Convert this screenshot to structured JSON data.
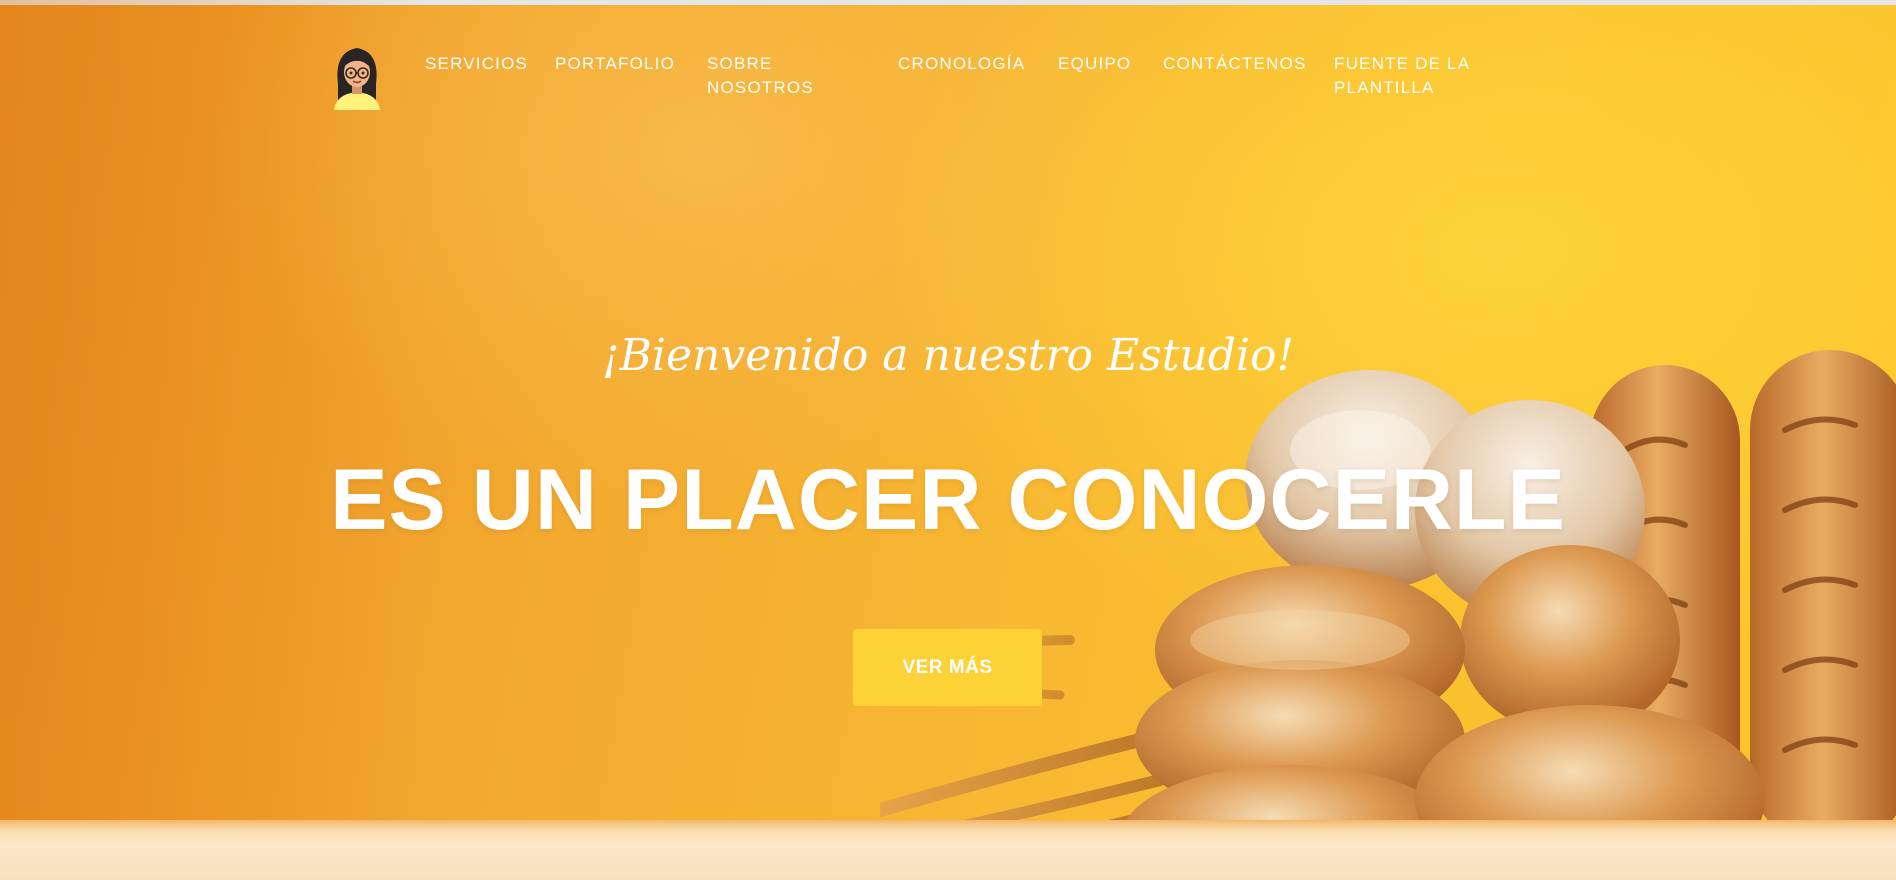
{
  "colors": {
    "accent": "#fed136",
    "text": "#ffffff",
    "background_left": "#e88d20",
    "background_right": "#fcc52c"
  },
  "navbar": {
    "logo_icon": "girl-avatar-icon",
    "items": [
      {
        "label": "SERVICIOS"
      },
      {
        "label": "PORTAFOLIO"
      },
      {
        "label": "SOBRE NOSOTROS"
      },
      {
        "label": "CRONOLOGÍA"
      },
      {
        "label": "EQUIPO"
      },
      {
        "label": "CONTÁCTENOS"
      },
      {
        "label": "FUENTE DE LA PLANTILLA"
      }
    ]
  },
  "hero": {
    "lead_in": "¡Bienvenido a nuestro Estudio!",
    "heading": "ES UN PLACER CONOCERLE",
    "cta_label": "VER MÁS",
    "background_icon": "bread-image"
  }
}
